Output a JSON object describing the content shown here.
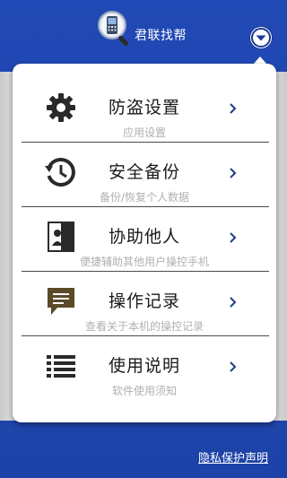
{
  "header": {
    "title": "君联找帮",
    "logo_icon": "phone-magnifier-icon",
    "menu_icon": "chevron-down-circle-icon"
  },
  "menu": {
    "items": [
      {
        "label": "防盗设置",
        "sublabel": "应用设置",
        "icon": "gear-icon"
      },
      {
        "label": "安全备份",
        "sublabel": "备份/恢复个人数据",
        "icon": "history-icon"
      },
      {
        "label": "协助他人",
        "sublabel": "便捷辅助其他用户操控手机",
        "icon": "person-card-icon"
      },
      {
        "label": "操作记录",
        "sublabel": "查看关于本机的操控记录",
        "icon": "message-icon"
      },
      {
        "label": "使用说明",
        "sublabel": "软件使用须知",
        "icon": "list-icon"
      }
    ]
  },
  "footer": {
    "privacy_link": "隐私保护声明"
  },
  "colors": {
    "background_blue": "#1f47b0",
    "panel": "#ffffff",
    "icon_dark": "#2a2a2a",
    "icon_accent": "#5a4a28",
    "chevron": "#1f3f86"
  }
}
